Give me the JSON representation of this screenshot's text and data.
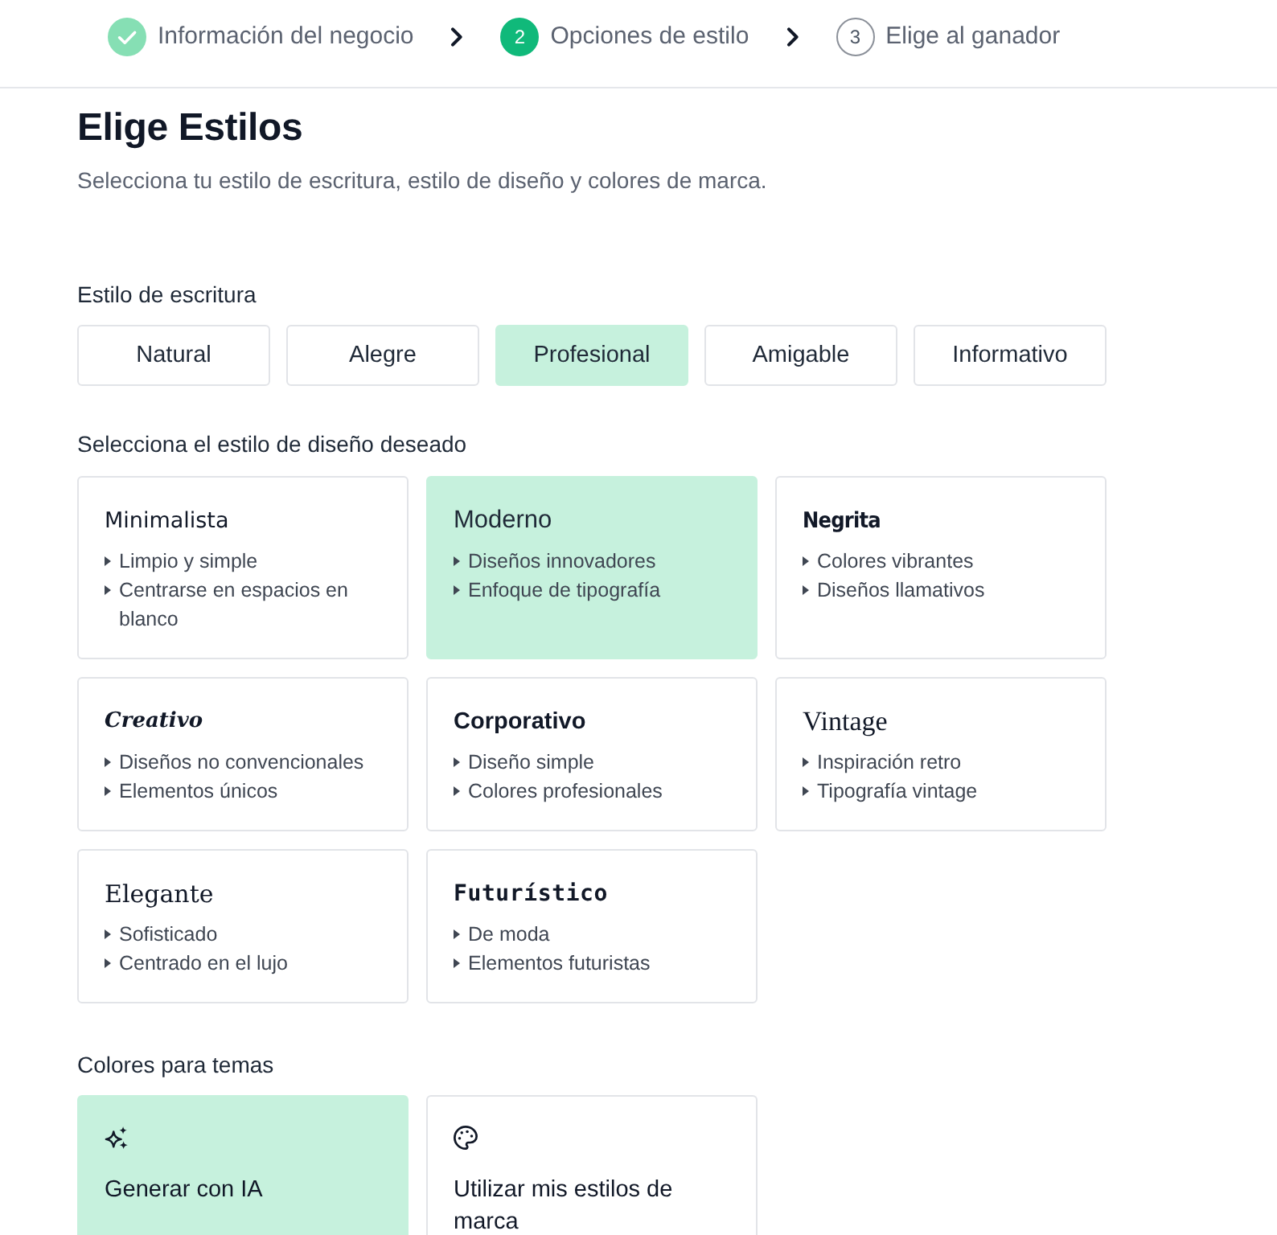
{
  "stepper": {
    "steps": [
      {
        "label": "Información del negocio",
        "kind": "completed"
      },
      {
        "number": "2",
        "label": "Opciones de estilo",
        "kind": "current"
      },
      {
        "number": "3",
        "label": "Elige al ganador",
        "kind": "upcoming"
      }
    ]
  },
  "header": {
    "title": "Elige Estilos",
    "subtitle": "Selecciona tu estilo de escritura, estilo de diseño y colores de marca."
  },
  "writing_style": {
    "label": "Estilo de escritura",
    "options": [
      {
        "label": "Natural",
        "selected": false
      },
      {
        "label": "Alegre",
        "selected": false
      },
      {
        "label": "Profesional",
        "selected": true
      },
      {
        "label": "Amigable",
        "selected": false
      },
      {
        "label": "Informativo",
        "selected": false
      }
    ]
  },
  "design_style": {
    "label": "Selecciona el estilo de diseño deseado",
    "cards": [
      {
        "title": "Minimalista",
        "kind": "sans",
        "selected": false,
        "features": [
          "Limpio y simple",
          "Centrarse en espacios en blanco"
        ]
      },
      {
        "title": "Moderno",
        "kind": "light",
        "selected": true,
        "features": [
          "Diseños innovadores",
          "Enfoque de tipografía"
        ]
      },
      {
        "title": "Negrita",
        "kind": "condensed",
        "selected": false,
        "features": [
          "Colores vibrantes",
          "Diseños llamativos"
        ]
      },
      {
        "title": "Creativo",
        "kind": "script",
        "selected": false,
        "features": [
          "Diseños no convencionales",
          "Elementos únicos"
        ]
      },
      {
        "title": "Corporativo",
        "kind": "semibold",
        "selected": false,
        "features": [
          "Diseño simple",
          "Colores profesionales"
        ]
      },
      {
        "title": "Vintage",
        "kind": "display",
        "selected": false,
        "features": [
          "Inspiración retro",
          "Tipografía vintage"
        ]
      },
      {
        "title": "Elegante",
        "kind": "serif",
        "selected": false,
        "features": [
          "Sofisticado",
          "Centrado en el lujo"
        ]
      },
      {
        "title": "Futurístico",
        "kind": "mono",
        "selected": false,
        "features": [
          "De moda",
          "Elementos futuristas"
        ]
      }
    ]
  },
  "theme_colors": {
    "label": "Colores para temas",
    "options": [
      {
        "label": "Generar con IA",
        "kind": "ai",
        "selected": true
      },
      {
        "label": "Utilizar mis estilos de marca",
        "kind": "brand",
        "selected": false
      }
    ]
  }
}
